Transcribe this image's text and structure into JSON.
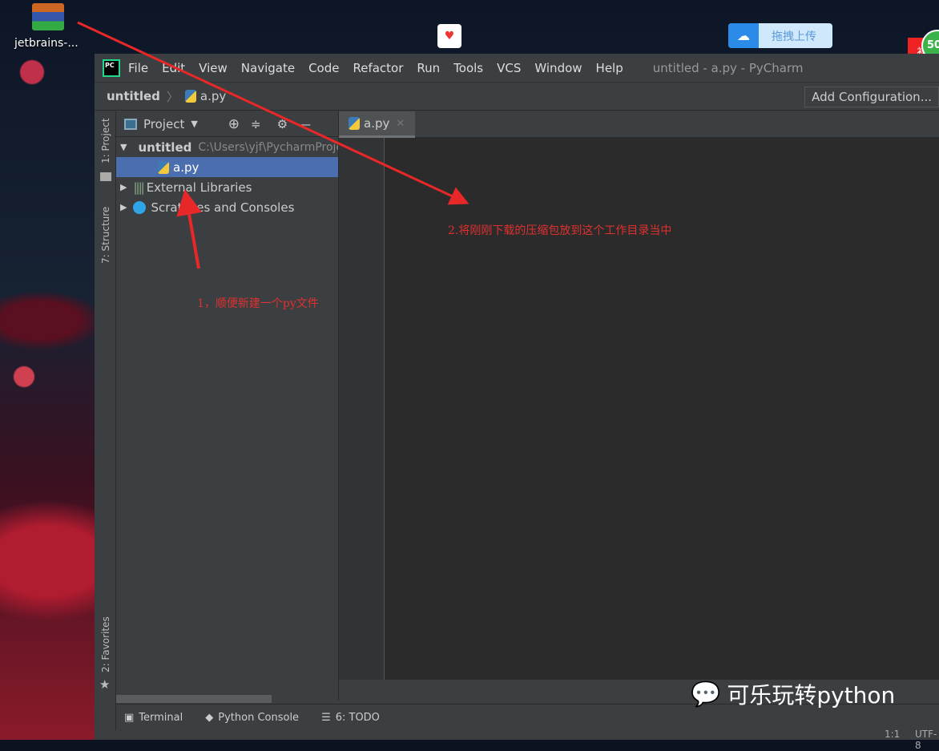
{
  "desktop": {
    "icon_label": "jetbrains-...",
    "upload_label": "拖拽上传",
    "badge_text": "补贴金",
    "badge_number": "50"
  },
  "ide": {
    "menu": [
      "File",
      "Edit",
      "View",
      "Navigate",
      "Code",
      "Refactor",
      "Run",
      "Tools",
      "VCS",
      "Window",
      "Help"
    ],
    "window_title": "untitled - a.py - PyCharm",
    "breadcrumb": {
      "project": "untitled",
      "file": "a.py"
    },
    "add_config": "Add Configuration...",
    "left_tools": [
      "1: Project",
      "7: Structure",
      "2: Favorites"
    ],
    "project_panel": {
      "title": "Project",
      "tree": [
        {
          "label": "untitled",
          "path": "C:\\Users\\yjf\\PycharmProjects"
        },
        {
          "label": "a.py"
        },
        {
          "label": "External Libraries"
        },
        {
          "label": "Scratches and Consoles"
        }
      ]
    },
    "editor_tab": "a.py",
    "bottom_tools": [
      "Terminal",
      "Python Console",
      "6: TODO"
    ],
    "status": {
      "position": "1:1",
      "encoding": "UTF-8"
    }
  },
  "annotations": [
    "1，顺便新建一个py文件",
    "2.将刚刚下载的压缩包放到这个工作目录当中"
  ],
  "watermark": "可乐玩转python",
  "colors": {
    "annotation": "#e03030",
    "selection": "#4b6eaf",
    "editor_bg": "#2b2b2b"
  }
}
